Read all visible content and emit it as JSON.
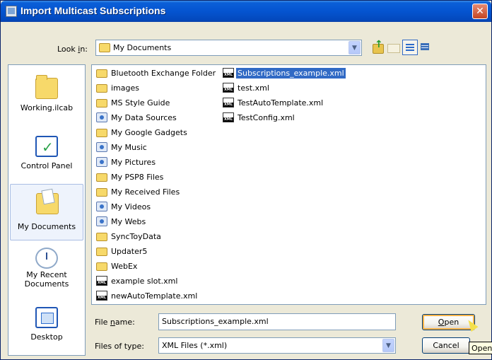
{
  "window": {
    "title": "Import Multicast Subscriptions",
    "close_glyph": "✕"
  },
  "look_in": {
    "label_pre": "Look ",
    "label_key": "i",
    "label_post": "n:",
    "value": "My Documents"
  },
  "places": [
    {
      "label": "Working.ilcab",
      "icon": "folder-icon"
    },
    {
      "label": "Control Panel",
      "icon": "control-panel-icon"
    },
    {
      "label": "My Documents",
      "icon": "my-documents-icon",
      "selected": true
    },
    {
      "label": "My Recent Documents",
      "icon": "recent-documents-icon"
    },
    {
      "label": "Desktop",
      "icon": "desktop-icon"
    }
  ],
  "files": {
    "column1": [
      {
        "name": "Bluetooth Exchange Folder",
        "type": "folder"
      },
      {
        "name": "images",
        "type": "folder"
      },
      {
        "name": "MS Style Guide",
        "type": "folder"
      },
      {
        "name": "My Data Sources",
        "type": "special"
      },
      {
        "name": "My Google Gadgets",
        "type": "folder"
      },
      {
        "name": "My Music",
        "type": "special"
      },
      {
        "name": "My Pictures",
        "type": "special"
      },
      {
        "name": "My PSP8 Files",
        "type": "folder"
      },
      {
        "name": "My Received Files",
        "type": "folder"
      },
      {
        "name": "My Videos",
        "type": "special"
      },
      {
        "name": "My Webs",
        "type": "special"
      },
      {
        "name": "SyncToyData",
        "type": "folder"
      },
      {
        "name": "Updater5",
        "type": "folder"
      },
      {
        "name": "WebEx",
        "type": "folder"
      },
      {
        "name": "example slot.xml",
        "type": "xml"
      },
      {
        "name": "newAutoTemplate.xml",
        "type": "xml"
      }
    ],
    "column2": [
      {
        "name": "Subscriptions_example.xml",
        "type": "xml",
        "selected": true
      },
      {
        "name": "test.xml",
        "type": "xml"
      },
      {
        "name": "TestAutoTemplate.xml",
        "type": "xml"
      },
      {
        "name": "TestConfig.xml",
        "type": "xml"
      }
    ]
  },
  "file_name": {
    "label_pre": "File ",
    "label_key": "n",
    "label_post": "ame:",
    "value": "Subscriptions_example.xml"
  },
  "file_type": {
    "label": "Files of type:",
    "value": "XML Files (*.xml)"
  },
  "buttons": {
    "open_key": "O",
    "open_rest": "pen",
    "cancel": "Cancel"
  },
  "tooltip": "Open"
}
